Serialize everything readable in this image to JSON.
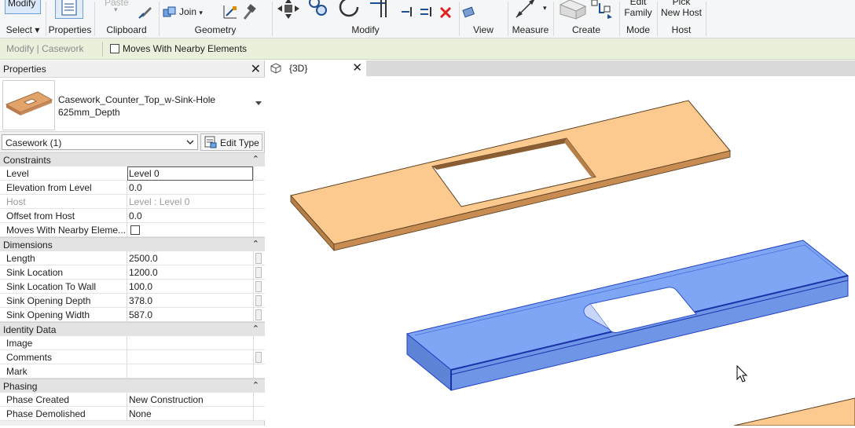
{
  "ribbon": {
    "modify_label": "Modify",
    "groups": {
      "select": "Select",
      "properties": "Properties",
      "clipboard": "Clipboard",
      "geometry": "Geometry",
      "modify": "Modify",
      "view": "View",
      "measure": "Measure",
      "create": "Create",
      "mode": "Mode",
      "host": "Host"
    },
    "paste_label": "Paste",
    "join_label": "Join",
    "edit_family_label": [
      "Edit",
      "Family"
    ],
    "pick_new_host_label": [
      "Pick",
      "New Host"
    ]
  },
  "context_bar": {
    "mode_label": "Modify | Casework",
    "moves_with_nearby_label": "Moves With Nearby Elements",
    "moves_with_nearby_checked": false
  },
  "properties": {
    "title": "Properties",
    "type_name_line1": "Casework_Counter_Top_w-Sink-Hole",
    "type_name_line2": "625mm_Depth",
    "filter_value": "Casework (1)",
    "edit_type_label": "Edit Type",
    "sections": [
      {
        "name": "Constraints",
        "rows": [
          {
            "key": "Level",
            "value": "Level 0"
          },
          {
            "key": "Elevation from Level",
            "value": "0.0"
          },
          {
            "key": "Host",
            "value": "Level : Level 0"
          },
          {
            "key": "Offset from Host",
            "value": "0.0"
          },
          {
            "key": "Moves With Nearby Eleme...",
            "value": ""
          }
        ]
      },
      {
        "name": "Dimensions",
        "rows": [
          {
            "key": "Length",
            "value": "2500.0"
          },
          {
            "key": "Sink Location",
            "value": "1200.0"
          },
          {
            "key": "Sink Location To Wall",
            "value": "100.0"
          },
          {
            "key": "Sink Opening Depth",
            "value": "378.0"
          },
          {
            "key": "Sink Opening Width",
            "value": "587.0"
          }
        ]
      },
      {
        "name": "Identity Data",
        "rows": [
          {
            "key": "Image",
            "value": ""
          },
          {
            "key": "Comments",
            "value": ""
          },
          {
            "key": "Mark",
            "value": ""
          }
        ]
      },
      {
        "name": "Phasing",
        "rows": [
          {
            "key": "Phase Created",
            "value": "New Construction"
          },
          {
            "key": "Phase Demolished",
            "value": "None"
          }
        ]
      }
    ]
  },
  "view_tab": {
    "label": "{3D}"
  },
  "colors": {
    "counter_fill": "#fcc98f",
    "selected_fill": "#7fa6f5",
    "ribbon_context": "#e9f1dd"
  }
}
